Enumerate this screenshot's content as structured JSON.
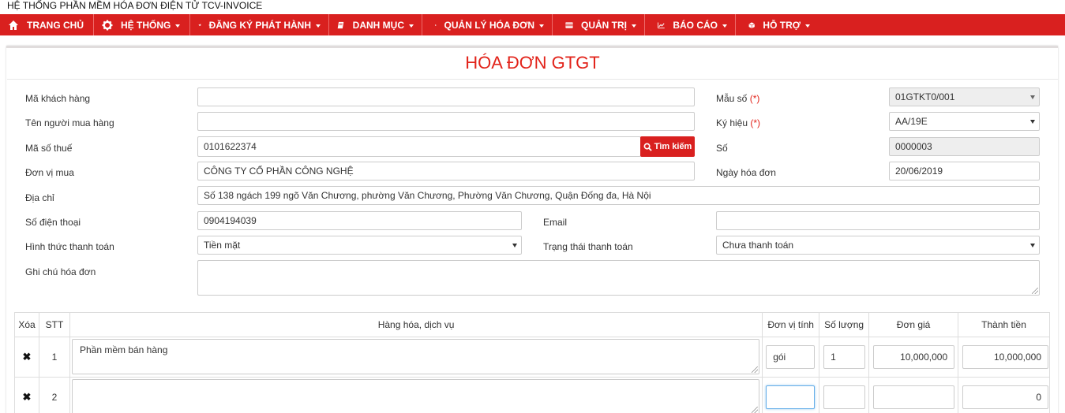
{
  "app": {
    "title": "HỆ THỐNG PHẦN MỀM HÓA ĐƠN ĐIỆN TỬ TCV-INVOICE"
  },
  "nav": [
    {
      "label": "TRANG CHỦ",
      "icon": "home-icon",
      "dropdown": false
    },
    {
      "label": "HỆ THỐNG",
      "icon": "gear-icon",
      "dropdown": true
    },
    {
      "label": "ĐĂNG KÝ PHÁT HÀNH",
      "icon": "plane-icon",
      "dropdown": true
    },
    {
      "label": "DANH MỤC",
      "icon": "book-icon",
      "dropdown": true
    },
    {
      "label": "QUẢN LÝ HÓA ĐƠN",
      "icon": "file-icon",
      "dropdown": true
    },
    {
      "label": "QUẢN TRỊ",
      "icon": "card-icon",
      "dropdown": true
    },
    {
      "label": "BÁO CÁO",
      "icon": "line-chart-icon",
      "dropdown": true
    },
    {
      "label": "HỖ TRỢ",
      "icon": "cube-icon",
      "dropdown": true
    }
  ],
  "form": {
    "title": "HÓA ĐƠN GTGT",
    "required_mark": "(*)",
    "customer_code": {
      "label": "Mã khách hàng",
      "value": ""
    },
    "buyer_name": {
      "label": "Tên người mua hàng",
      "value": ""
    },
    "tax_code": {
      "label": "Mã số thuế",
      "value": "0101622374"
    },
    "search_button": "Tìm kiếm",
    "buyer_unit": {
      "label": "Đơn vị mua",
      "value": "CÔNG TY CỔ PHẦN CÔNG NGHỆ"
    },
    "address": {
      "label": "Địa chỉ",
      "value": "Số 138 ngách 199 ngõ Văn Chương, phường Văn Chương, Phường Văn Chương, Quận Đống đa, Hà Nội"
    },
    "phone": {
      "label": "Số điện thoại",
      "value": "0904194039"
    },
    "email": {
      "label": "Email",
      "value": ""
    },
    "payment_method": {
      "label": "Hình thức thanh toán",
      "value": "Tiền mặt"
    },
    "payment_status": {
      "label": "Trạng thái thanh toán",
      "value": "Chưa thanh toán"
    },
    "note": {
      "label": "Ghi chú hóa đơn",
      "value": ""
    },
    "template": {
      "label": "Mẫu số",
      "value": "01GTKT0/001"
    },
    "symbol": {
      "label": "Ký hiệu",
      "value": "AA/19E"
    },
    "number": {
      "label": "Số",
      "value": "0000003"
    },
    "invoice_date": {
      "label": "Ngày hóa đơn",
      "value": "20/06/2019"
    }
  },
  "table": {
    "headers": [
      "Xóa",
      "STT",
      "Hàng hóa, dịch vụ",
      "Đơn vị tính",
      "Số lượng",
      "Đơn giá",
      "Thành tiền"
    ],
    "delete_glyph": "✖",
    "rows": [
      {
        "stt": "1",
        "item": "Phần mềm bán hàng",
        "unit": "gói",
        "qty": "1",
        "price": "10,000,000",
        "amount": "10,000,000"
      },
      {
        "stt": "2",
        "item": "",
        "unit": "",
        "qty": "",
        "price": "",
        "amount": "0"
      }
    ]
  }
}
